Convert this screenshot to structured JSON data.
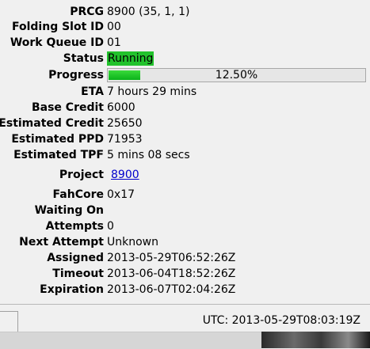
{
  "fields": [
    {
      "label": "PRCG",
      "value": "8900 (35, 1, 1)"
    },
    {
      "label": "Folding Slot ID",
      "value": "00"
    },
    {
      "label": "Work Queue ID",
      "value": "01"
    },
    {
      "label": "Status",
      "value": "Running"
    },
    {
      "label": "Progress",
      "value": "12.50%",
      "fraction": 0.125
    },
    {
      "label": "ETA",
      "value": "7 hours 29 mins"
    },
    {
      "label": "Base Credit",
      "value": "6000"
    },
    {
      "label": "Estimated Credit",
      "value": "25650"
    },
    {
      "label": "Estimated PPD",
      "value": "71953"
    },
    {
      "label": "Estimated TPF",
      "value": "5 mins 08 secs"
    },
    {
      "label": "Project",
      "value": "8900"
    },
    {
      "label": "FahCore",
      "value": "0x17"
    },
    {
      "label": "Waiting On",
      "value": ""
    },
    {
      "label": "Attempts",
      "value": "0"
    },
    {
      "label": "Next Attempt",
      "value": "Unknown"
    },
    {
      "label": "Assigned",
      "value": "2013-05-29T06:52:26Z"
    },
    {
      "label": "Timeout",
      "value": "2013-06-04T18:52:26Z"
    },
    {
      "label": "Expiration",
      "value": "2013-06-07T02:04:26Z"
    }
  ],
  "colors": {
    "status_running": "#22c22c",
    "progress_fill": "#16c02a",
    "link": "#0000cc"
  },
  "statusbar": {
    "utc": "UTC: 2013-05-29T08:03:19Z"
  }
}
